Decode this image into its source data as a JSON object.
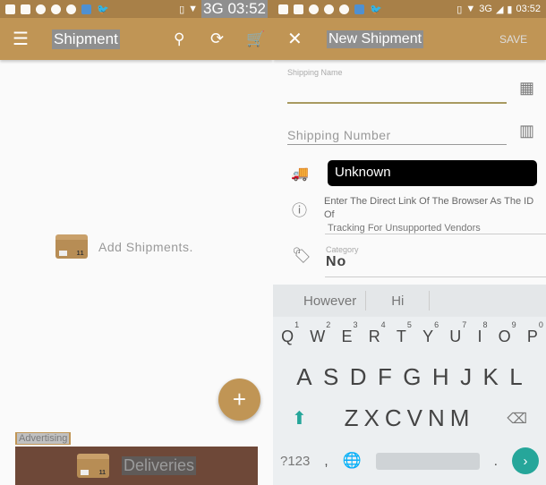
{
  "left": {
    "status": {
      "time": "03:52",
      "network": "3G"
    },
    "appbar": {
      "title": "Shipment",
      "icons": [
        "menu-icon",
        "search-icon",
        "sync-icon",
        "cart-icon"
      ]
    },
    "empty_message": "Add Shipments.",
    "fab_label": "+",
    "ad_label": "Advertising",
    "banner_text": "Deliveries"
  },
  "right": {
    "status": {
      "time": "03:52",
      "network": "3G"
    },
    "appbar": {
      "title": "New Shipment",
      "save": "SAVE"
    },
    "form": {
      "shipping_name_label": "Shipping Name",
      "shipping_name_value": "",
      "shipping_number_placeholder": "Shipping Number",
      "courier": "Unknown",
      "info_text_1": "Enter The Direct Link Of The Browser As The ID Of",
      "info_text_2": "Tracking For Unsupported Vendors",
      "category_label": "Category",
      "category_value": "No"
    },
    "keyboard": {
      "suggestions": [
        "However",
        "Hi"
      ],
      "row1": [
        "Q",
        "W",
        "E",
        "R",
        "T",
        "Y",
        "U",
        "I",
        "O",
        "P"
      ],
      "row1_nums": [
        "1",
        "2",
        "3",
        "4",
        "5",
        "6",
        "7",
        "8",
        "9",
        "0"
      ],
      "row2": [
        "A",
        "S",
        "D",
        "F",
        "G",
        "H",
        "J",
        "K",
        "L"
      ],
      "row3": [
        "Z",
        "X",
        "C",
        "V",
        "N",
        "M"
      ],
      "symbols": "?123",
      "comma": ",",
      "period": ".",
      "accent": "#26a69a"
    }
  },
  "colors": {
    "appbar": "#c09555",
    "statusbar": "#a88048",
    "banner": "#6e4838"
  }
}
